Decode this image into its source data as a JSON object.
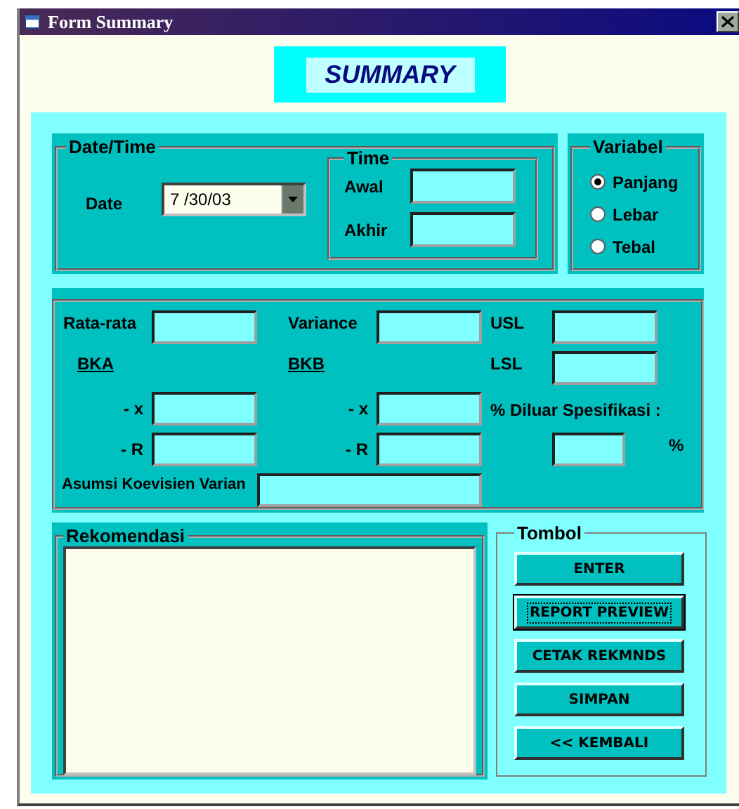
{
  "window": {
    "title": "Form Summary"
  },
  "header": {
    "title": "SUMMARY"
  },
  "datetime": {
    "label": "Date/Time",
    "date_label": "Date",
    "date_value": "7 /30/03",
    "time": {
      "label": "Time",
      "start_label": "Awal",
      "end_label": "Akhir"
    }
  },
  "variabel": {
    "label": "Variabel",
    "options": [
      {
        "label": "Panjang",
        "selected": true
      },
      {
        "label": "Lebar",
        "selected": false
      },
      {
        "label": "Tebal",
        "selected": false
      }
    ]
  },
  "stats": {
    "mean_label": "Rata-rata",
    "variance_label": "Variance",
    "usl_label": "USL",
    "bka_label": "BKA",
    "bkb_label": "BKB",
    "lsl_label": "LSL",
    "bka_x_label": "- x",
    "bka_r_label": "- R",
    "bkb_x_label": "- x",
    "bkb_r_label": "- R",
    "out_of_spec_label": "% Diluar Spesifikasi :",
    "percent_unit": "%",
    "cv_label": "Asumsi Koevisien Varian"
  },
  "rekomendasi": {
    "label": "Rekomendasi"
  },
  "tombol": {
    "label": "Tombol",
    "buttons": [
      {
        "label": "ENTER",
        "focused": false
      },
      {
        "label": "REPORT PREVIEW",
        "focused": true
      },
      {
        "label": "CETAK REKMNDS",
        "focused": false
      },
      {
        "label": "SIMPAN",
        "focused": false
      },
      {
        "label": "<< KEMBALI",
        "focused": false
      }
    ]
  }
}
